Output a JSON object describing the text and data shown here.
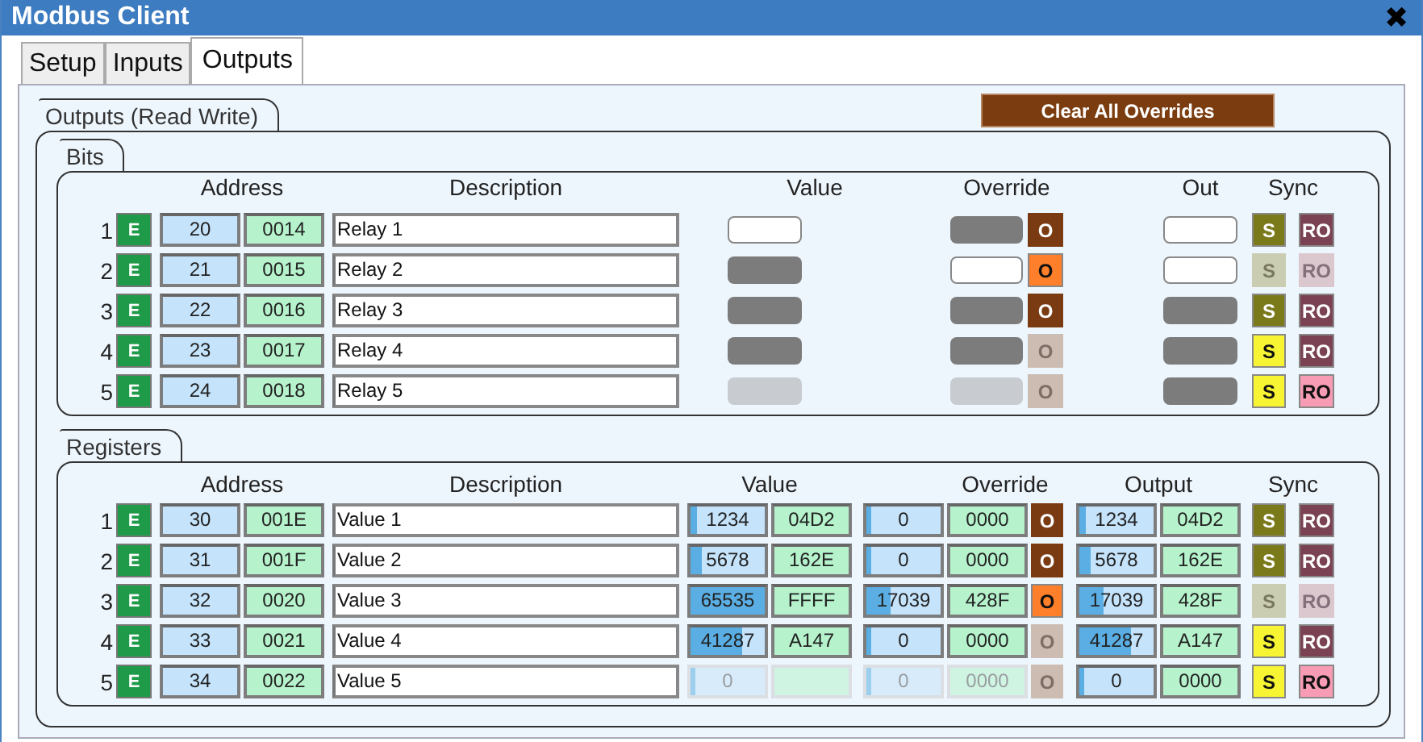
{
  "window": {
    "title": "Modbus Client",
    "close": "✖"
  },
  "tabs": [
    {
      "label": "Setup",
      "selected": false
    },
    {
      "label": "Inputs",
      "selected": false
    },
    {
      "label": "Outputs",
      "selected": true
    }
  ],
  "outputs": {
    "title": "Outputs (Read Write)",
    "clear_button": "Clear All Overrides",
    "bits": {
      "title": "Bits",
      "columns": {
        "address": "Address",
        "description": "Description",
        "value": "Value",
        "override": "Override",
        "out": "Out",
        "sync": "Sync"
      },
      "rows": [
        {
          "index": "1",
          "enable": "E",
          "address": "20",
          "address_hex": "0014",
          "description": "Relay 1",
          "value": {
            "on": true,
            "disabled": false
          },
          "override": {
            "on": false,
            "disabled": false
          },
          "override_button": {
            "label": "O",
            "active": false,
            "disabled": false
          },
          "out": {
            "on": true,
            "disabled": false
          },
          "sync": {
            "label": "S",
            "pending": false,
            "disabled": false
          },
          "read_only": {
            "label": "RO",
            "alert": false,
            "disabled": false
          }
        },
        {
          "index": "2",
          "enable": "E",
          "address": "21",
          "address_hex": "0015",
          "description": "Relay 2",
          "value": {
            "on": false,
            "disabled": false
          },
          "override": {
            "on": true,
            "disabled": false
          },
          "override_button": {
            "label": "O",
            "active": true,
            "disabled": false
          },
          "out": {
            "on": true,
            "disabled": false
          },
          "sync": {
            "label": "S",
            "pending": false,
            "disabled": true
          },
          "read_only": {
            "label": "RO",
            "alert": false,
            "disabled": true
          }
        },
        {
          "index": "3",
          "enable": "E",
          "address": "22",
          "address_hex": "0016",
          "description": "Relay 3",
          "value": {
            "on": false,
            "disabled": false
          },
          "override": {
            "on": false,
            "disabled": false
          },
          "override_button": {
            "label": "O",
            "active": false,
            "disabled": false
          },
          "out": {
            "on": false,
            "disabled": false
          },
          "sync": {
            "label": "S",
            "pending": false,
            "disabled": false
          },
          "read_only": {
            "label": "RO",
            "alert": false,
            "disabled": false
          }
        },
        {
          "index": "4",
          "enable": "E",
          "address": "23",
          "address_hex": "0017",
          "description": "Relay 4",
          "value": {
            "on": false,
            "disabled": false
          },
          "override": {
            "on": false,
            "disabled": false
          },
          "override_button": {
            "label": "O",
            "active": false,
            "disabled": true
          },
          "out": {
            "on": false,
            "disabled": false
          },
          "sync": {
            "label": "S",
            "pending": true,
            "disabled": false
          },
          "read_only": {
            "label": "RO",
            "alert": false,
            "disabled": false
          }
        },
        {
          "index": "5",
          "enable": "E",
          "address": "24",
          "address_hex": "0018",
          "description": "Relay 5",
          "value": {
            "on": false,
            "disabled": true
          },
          "override": {
            "on": false,
            "disabled": true
          },
          "override_button": {
            "label": "O",
            "active": false,
            "disabled": true
          },
          "out": {
            "on": false,
            "disabled": false
          },
          "sync": {
            "label": "S",
            "pending": true,
            "disabled": false
          },
          "read_only": {
            "label": "RO",
            "alert": true,
            "disabled": false
          }
        }
      ]
    },
    "registers": {
      "title": "Registers",
      "columns": {
        "address": "Address",
        "description": "Description",
        "value": "Value",
        "override": "Override",
        "output": "Output",
        "sync": "Sync"
      },
      "rows": [
        {
          "index": "1",
          "enable": "E",
          "address": "30",
          "address_hex": "001E",
          "description": "Value 1",
          "value": {
            "dec": "1234",
            "hex": "04D2",
            "level": 0.019,
            "disabled": false
          },
          "override": {
            "dec": "0",
            "hex": "0000",
            "level": 0,
            "disabled": false
          },
          "override_button": {
            "label": "O",
            "active": false,
            "disabled": false
          },
          "output": {
            "dec": "1234",
            "hex": "04D2",
            "level": 0.019,
            "disabled": false
          },
          "sync": {
            "label": "S",
            "pending": false,
            "disabled": false
          },
          "read_only": {
            "label": "RO",
            "alert": false,
            "disabled": false
          }
        },
        {
          "index": "2",
          "enable": "E",
          "address": "31",
          "address_hex": "001F",
          "description": "Value 2",
          "value": {
            "dec": "5678",
            "hex": "162E",
            "level": 0.087,
            "disabled": false
          },
          "override": {
            "dec": "0",
            "hex": "0000",
            "level": 0,
            "disabled": false
          },
          "override_button": {
            "label": "O",
            "active": false,
            "disabled": false
          },
          "output": {
            "dec": "5678",
            "hex": "162E",
            "level": 0.087,
            "disabled": false
          },
          "sync": {
            "label": "S",
            "pending": false,
            "disabled": false
          },
          "read_only": {
            "label": "RO",
            "alert": false,
            "disabled": false
          }
        },
        {
          "index": "3",
          "enable": "E",
          "address": "32",
          "address_hex": "0020",
          "description": "Value 3",
          "value": {
            "dec": "65535",
            "hex": "FFFF",
            "level": 1,
            "disabled": false
          },
          "override": {
            "dec": "17039",
            "hex": "428F",
            "level": 0.26,
            "disabled": false
          },
          "override_button": {
            "label": "O",
            "active": true,
            "disabled": false
          },
          "output": {
            "dec": "17039",
            "hex": "428F",
            "level": 0.26,
            "disabled": false
          },
          "sync": {
            "label": "S",
            "pending": false,
            "disabled": true
          },
          "read_only": {
            "label": "RO",
            "alert": false,
            "disabled": true
          }
        },
        {
          "index": "4",
          "enable": "E",
          "address": "33",
          "address_hex": "0021",
          "description": "Value 4",
          "value": {
            "dec": "41287",
            "hex": "A147",
            "level": 0.63,
            "disabled": false
          },
          "override": {
            "dec": "0",
            "hex": "0000",
            "level": 0,
            "disabled": false
          },
          "override_button": {
            "label": "O",
            "active": false,
            "disabled": true
          },
          "output": {
            "dec": "41287",
            "hex": "A147",
            "level": 0.63,
            "disabled": false
          },
          "sync": {
            "label": "S",
            "pending": true,
            "disabled": false
          },
          "read_only": {
            "label": "RO",
            "alert": false,
            "disabled": false
          }
        },
        {
          "index": "5",
          "enable": "E",
          "address": "34",
          "address_hex": "0022",
          "description": "Value 5",
          "value": {
            "dec": "0",
            "level": 0,
            "disabled": true
          },
          "override": {
            "dec": "0",
            "hex": "0000",
            "level": 0,
            "disabled": true
          },
          "override_button": {
            "label": "O",
            "active": false,
            "disabled": true
          },
          "output": {
            "dec": "0",
            "hex": "0000",
            "level": 0,
            "disabled": false
          },
          "sync": {
            "label": "S",
            "pending": true,
            "disabled": false
          },
          "read_only": {
            "label": "RO",
            "alert": true,
            "disabled": false
          }
        }
      ]
    }
  }
}
